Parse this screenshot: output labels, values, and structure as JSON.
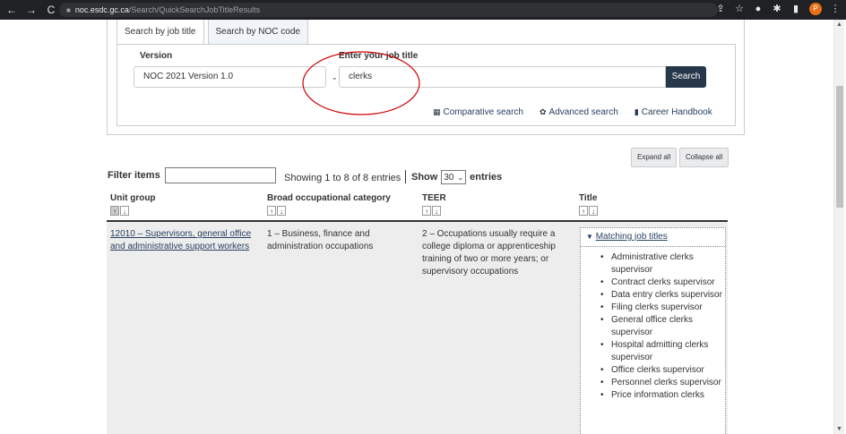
{
  "browser": {
    "url_host": "noc.esdc.gc.ca",
    "url_path": "/Search/QuickSearchJobTitleResults",
    "profile_initial": "P"
  },
  "search": {
    "tabs": [
      {
        "label": "Search by job title",
        "active": true
      },
      {
        "label": "Search by NOC code",
        "active": false
      }
    ],
    "version_label": "Version",
    "version_value": "NOC 2021 Version 1.0",
    "job_label": "Enter your job title",
    "job_value": "clerks",
    "search_button": "Search",
    "links": [
      {
        "label": "Comparative search",
        "icon": "grid-icon"
      },
      {
        "label": "Advanced search",
        "icon": "gear-icon"
      },
      {
        "label": "Career Handbook",
        "icon": "book-icon"
      }
    ]
  },
  "controls": {
    "expand_all": "Expand all",
    "collapse_all": "Collapse all",
    "filter_label": "Filter items",
    "showing": "Showing 1 to 8 of 8 entries",
    "show_label": "Show",
    "show_value": "30",
    "entries_label": "entries"
  },
  "table": {
    "headers": [
      "Unit group",
      "Broad occupational category",
      "TEER",
      "Title"
    ],
    "row": {
      "unit_group": "12010 – Supervisors, general office and administrative support workers",
      "broad_category": "1 – Business, finance and administration occupations",
      "teer": "2 – Occupations usually require a college diploma or apprenticeship training of two or more years; or supervisory occupations",
      "matching_label": "Matching job titles",
      "titles": [
        "Administrative clerks supervisor",
        "Contract clerks supervisor",
        "Data entry clerks supervisor",
        "Filing clerks supervisor",
        "General office clerks supervisor",
        "Hospital admitting clerks supervisor",
        "Office clerks supervisor",
        "Personnel clerks supervisor",
        "Price information clerks"
      ]
    }
  },
  "colors": {
    "annotation": "#cc0000",
    "button_dark": "#26374a",
    "link": "#284162"
  }
}
